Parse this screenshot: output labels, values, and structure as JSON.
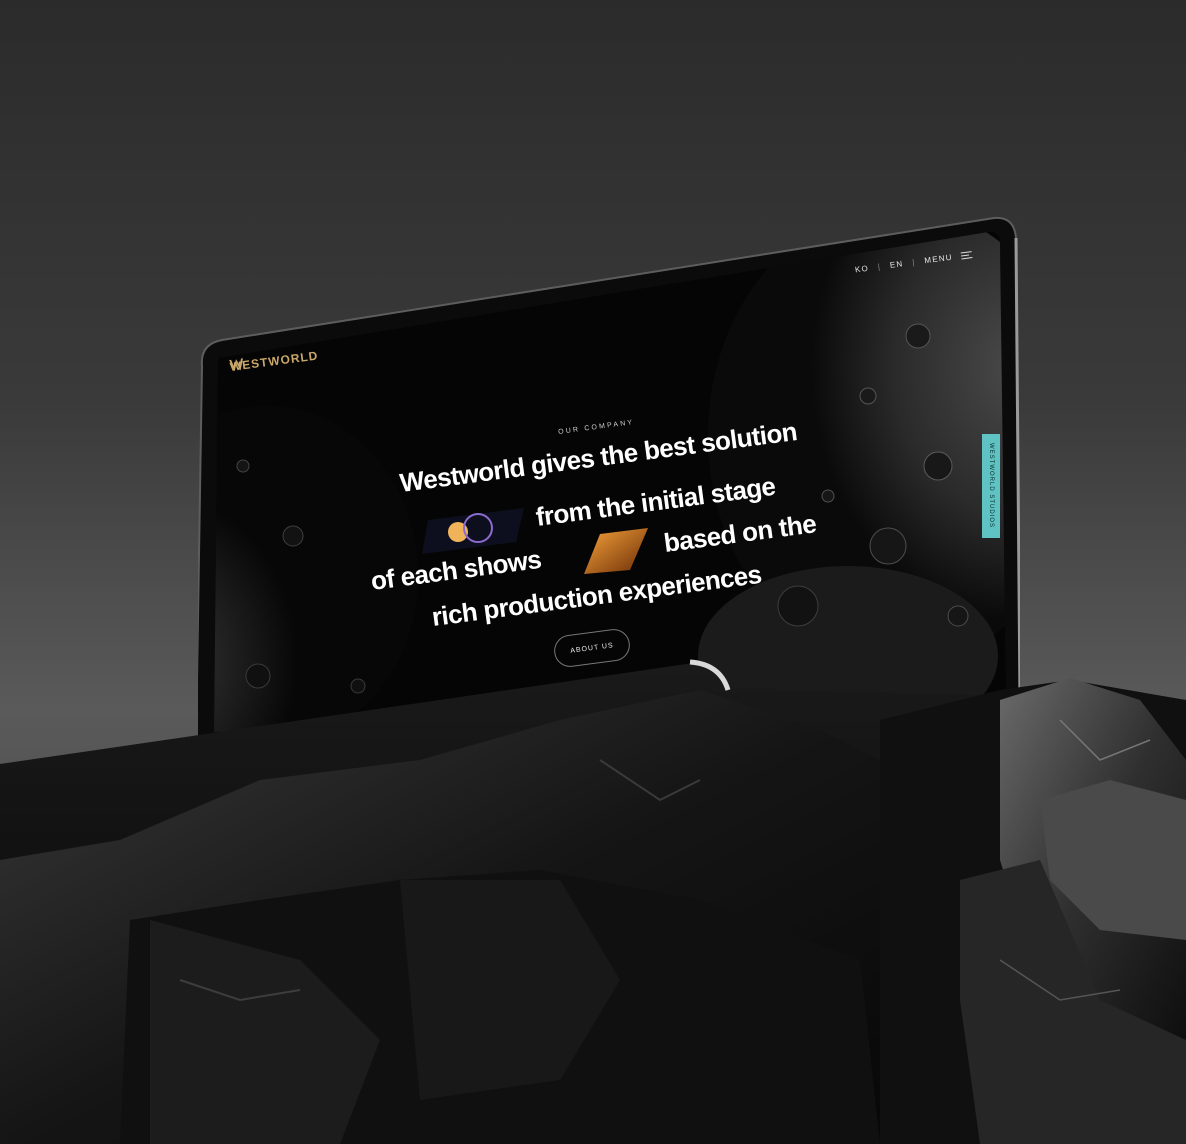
{
  "site": {
    "brand": "WESTWORLD",
    "nav": {
      "lang_ko": "KO",
      "lang_en": "EN",
      "menu_label": "MENU"
    },
    "hero": {
      "kicker": "OUR COMPANY",
      "line1": "Westworld gives the best solution",
      "line2": "from the initial stage",
      "line3a": "of each shows",
      "line3b": "based on the",
      "line4": "rich production experiences",
      "cta": "ABOUT US"
    },
    "side_tab": "WESTWORLD STUDIOS"
  },
  "icons": {
    "logo": "w-logo-icon",
    "menu": "hamburger-icon"
  },
  "colors": {
    "accent_gold": "#c9a86a",
    "side_tab": "#5fc3c3",
    "screen_bg": "#050505"
  }
}
